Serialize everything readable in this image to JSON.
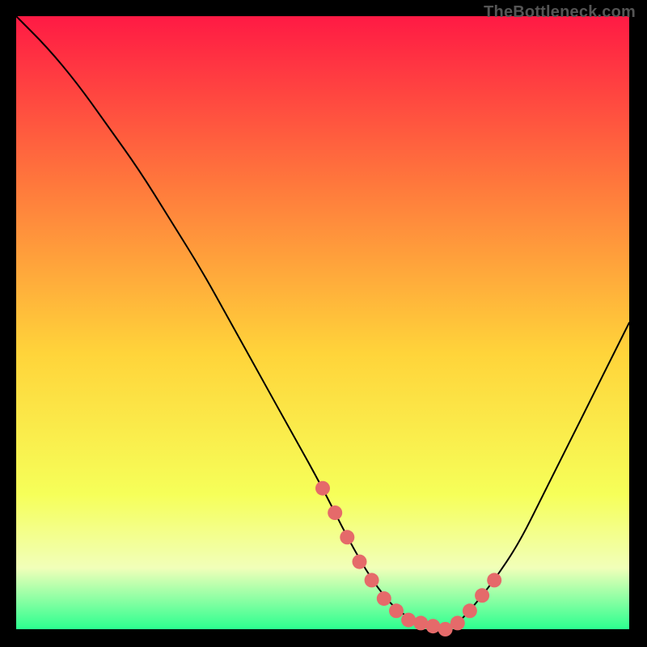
{
  "watermark": "TheBottleneck.com",
  "colors": {
    "top": "#ff1a44",
    "mid_upper": "#ff7a3c",
    "mid": "#ffd43a",
    "mid_lower": "#f6ff59",
    "band_light": "#f1ffb9",
    "bottom": "#2bff8f",
    "curve": "#000000",
    "marker": "#e56a6a",
    "frame": "#000000"
  },
  "chart_data": {
    "type": "line",
    "title": "",
    "subtitle": "",
    "xlabel": "",
    "ylabel": "",
    "xlim": [
      0,
      100
    ],
    "ylim": [
      0,
      100
    ],
    "grid": false,
    "legend": false,
    "series": [
      {
        "name": "bottleneck-curve",
        "x": [
          0,
          5,
          10,
          15,
          20,
          25,
          30,
          35,
          40,
          45,
          50,
          54,
          58,
          62,
          66,
          70,
          72,
          74,
          78,
          82,
          86,
          90,
          94,
          98,
          100
        ],
        "values": [
          100,
          95,
          89,
          82,
          75,
          67,
          59,
          50,
          41,
          32,
          23,
          15,
          8,
          3,
          1,
          0,
          1,
          3,
          8,
          14,
          22,
          30,
          38,
          46,
          50
        ]
      }
    ],
    "markers": {
      "name": "highlighted-points",
      "x": [
        50,
        52,
        54,
        56,
        58,
        60,
        62,
        64,
        66,
        68,
        70,
        72,
        74,
        76,
        78
      ],
      "values": [
        23,
        19,
        15,
        11,
        8,
        5,
        3,
        1.5,
        1,
        0.5,
        0,
        1,
        3,
        5.5,
        8
      ]
    }
  }
}
